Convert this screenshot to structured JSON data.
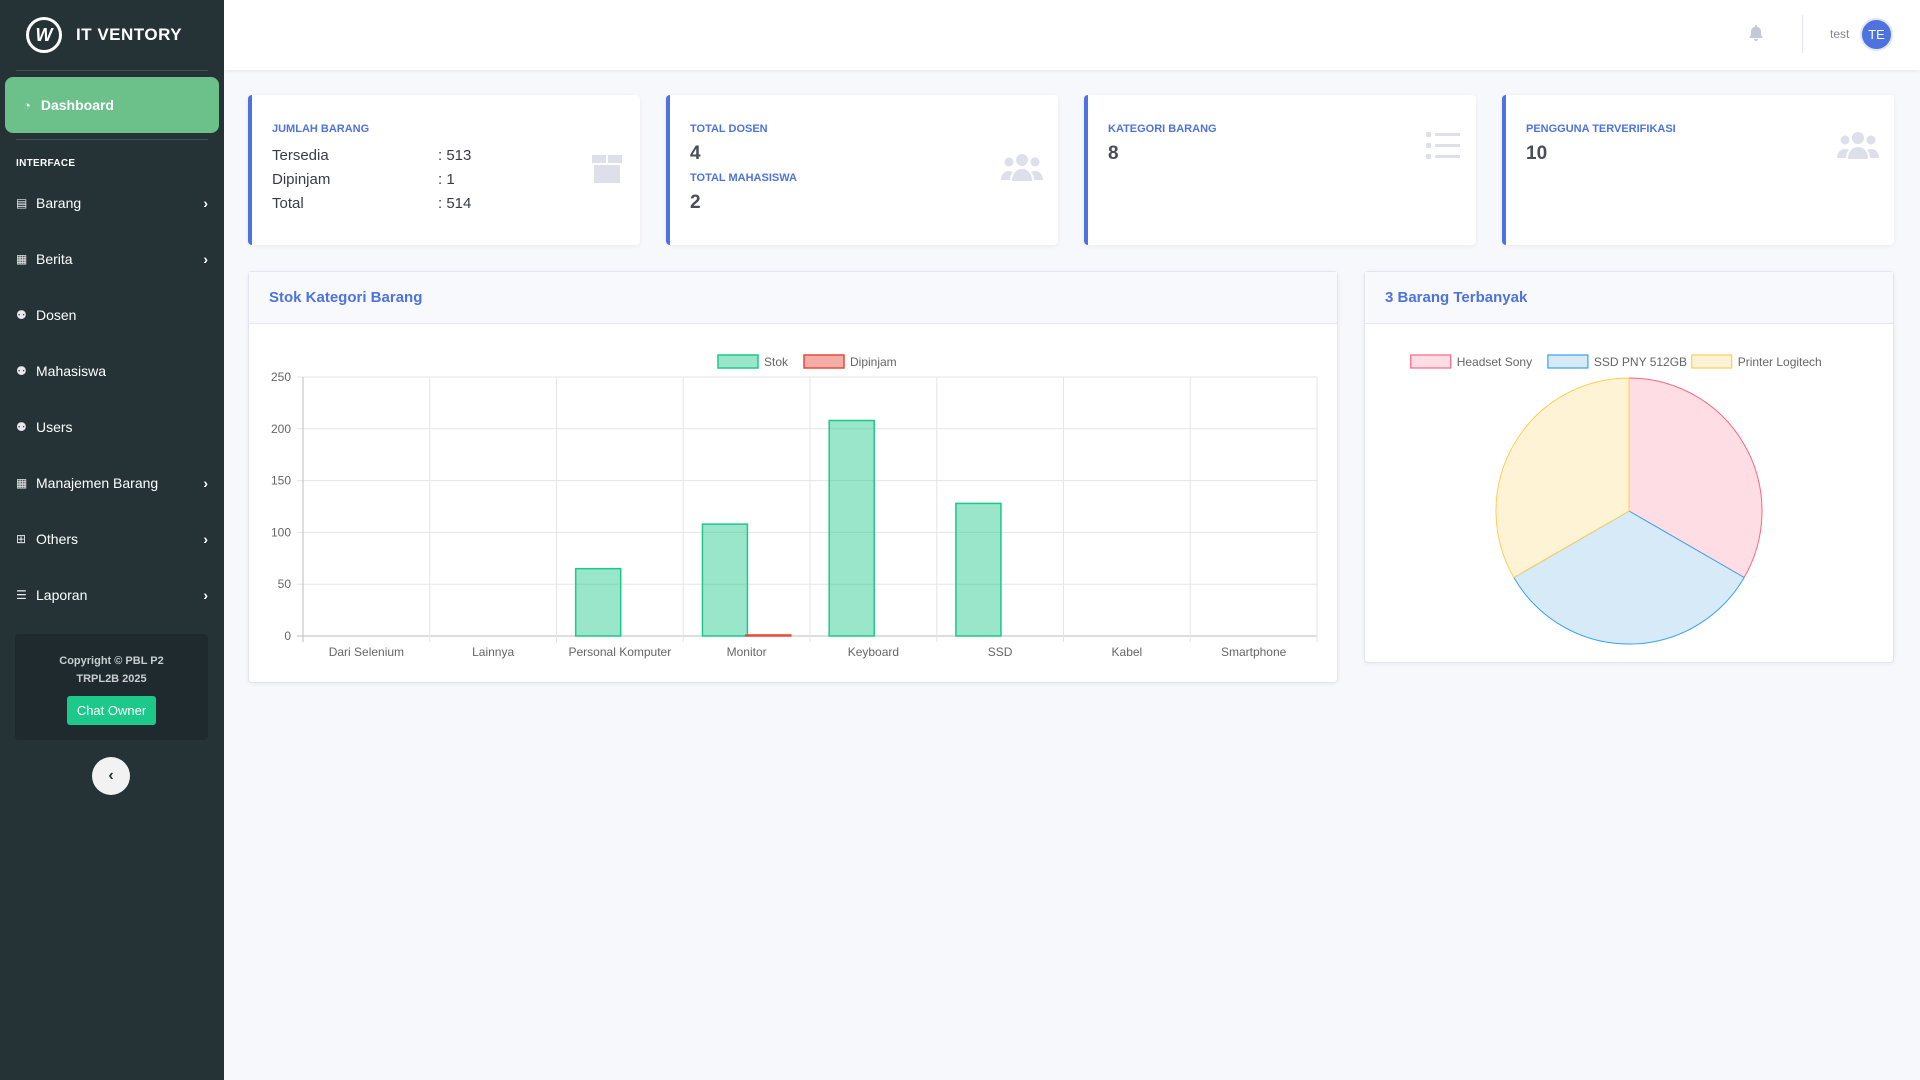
{
  "brand": {
    "logo_text": "W",
    "name": "IT VENTORY"
  },
  "sidebar": {
    "active": {
      "icon": "dashboard-icon",
      "label": "Dashboard"
    },
    "section_heading": "INTERFACE",
    "items": [
      {
        "icon": "archive-icon",
        "label": "Barang",
        "has_submenu": true
      },
      {
        "icon": "calendar-icon",
        "label": "Berita",
        "has_submenu": true
      },
      {
        "icon": "users-icon",
        "label": "Dosen",
        "has_submenu": false
      },
      {
        "icon": "users-icon",
        "label": "Mahasiswa",
        "has_submenu": false
      },
      {
        "icon": "users-icon",
        "label": "Users",
        "has_submenu": false
      },
      {
        "icon": "calendar-icon",
        "label": "Manajemen Barang",
        "has_submenu": true
      },
      {
        "icon": "sitemap-icon",
        "label": "Others",
        "has_submenu": true
      },
      {
        "icon": "list-icon",
        "label": "Laporan",
        "has_submenu": true
      }
    ],
    "copyright_line1": "Copyright © PBL P2",
    "copyright_line2": "TRPL2B 2025",
    "chat_button": "Chat Owner"
  },
  "topbar": {
    "username": "test",
    "avatar_initials": "TE"
  },
  "cards": {
    "barang": {
      "title": "JUMLAH BARANG",
      "rows": [
        {
          "label": "Tersedia",
          "value": ": 513"
        },
        {
          "label": "Dipinjam",
          "value": ": 1"
        },
        {
          "label": "Total",
          "value": ": 514"
        }
      ]
    },
    "dosen": {
      "title": "TOTAL DOSEN",
      "value": "4",
      "title2": "TOTAL MAHASISWA",
      "value2": "2"
    },
    "kategori": {
      "title": "KATEGORI BARANG",
      "value": "8"
    },
    "pengguna": {
      "title": "PENGGUNA TERVERIFIKASI",
      "value": "10"
    }
  },
  "panels": {
    "bar_title": "Stok Kategori Barang",
    "pie_title": "3 Barang Terbanyak"
  },
  "chart_data": [
    {
      "type": "bar",
      "categories": [
        "Dari Selenium",
        "Lainnya",
        "Personal Komputer",
        "Monitor",
        "Keyboard",
        "SSD",
        "Kabel",
        "Smartphone"
      ],
      "series": [
        {
          "name": "Stok",
          "values": [
            0,
            0,
            65,
            108,
            208,
            128,
            0,
            0
          ],
          "color": "#1cc88a"
        },
        {
          "name": "Dipinjam",
          "values": [
            0,
            0,
            0,
            1,
            0,
            0,
            0,
            0
          ],
          "color": "#e74a3b"
        }
      ],
      "yticks": [
        0,
        50,
        100,
        150,
        200,
        250
      ],
      "ylim": [
        0,
        250
      ],
      "legend": "top-center",
      "grid": true
    },
    {
      "type": "pie",
      "labels": [
        "Headset Sony",
        "SSD PNY 512GB",
        "Printer Logitech"
      ],
      "values": [
        1,
        1,
        1
      ],
      "fill_colors": [
        "#ffdde4",
        "#d6eaf8",
        "#fff3d6"
      ],
      "stroke_colors": [
        "#ff6384",
        "#36a2eb",
        "#ffcd56"
      ],
      "legend": "top-center"
    }
  ]
}
